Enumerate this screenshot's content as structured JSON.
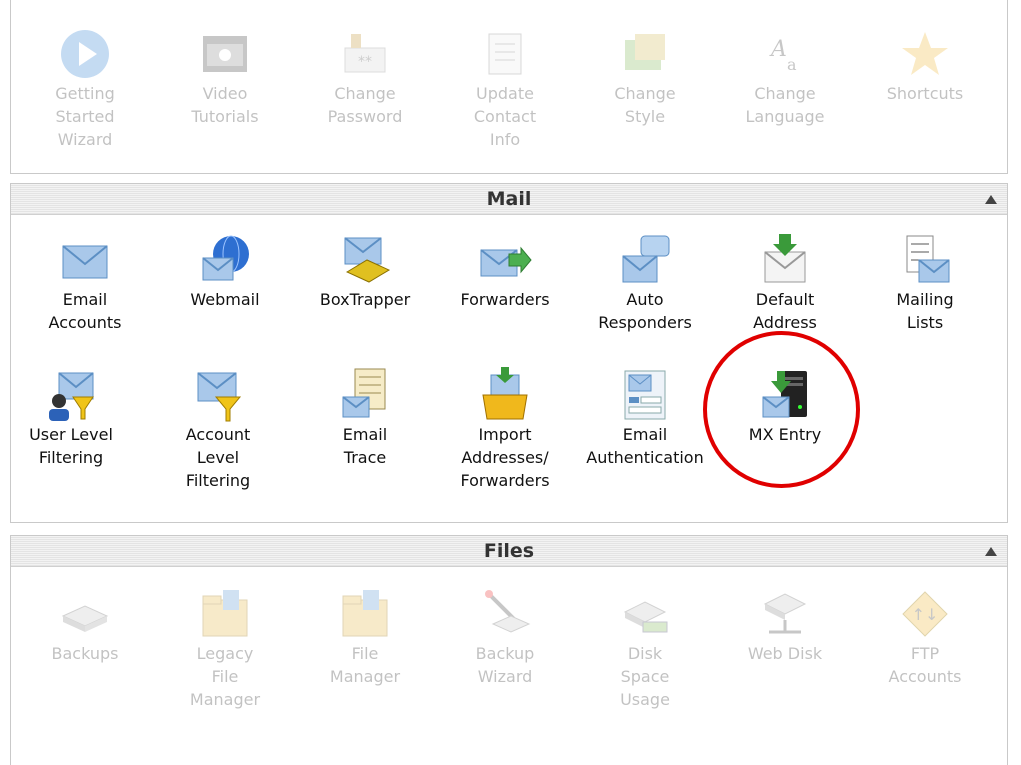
{
  "top": {
    "items": [
      {
        "label": "Getting\nStarted\nWizard",
        "icon": "play-icon"
      },
      {
        "label": "Video\nTutorials",
        "icon": "video-icon"
      },
      {
        "label": "Change\nPassword",
        "icon": "password-icon"
      },
      {
        "label": "Update\nContact\nInfo",
        "icon": "contact-icon"
      },
      {
        "label": "Change\nStyle",
        "icon": "style-icon"
      },
      {
        "label": "Change\nLanguage",
        "icon": "language-icon"
      },
      {
        "label": "Shortcuts",
        "icon": "star-icon"
      }
    ]
  },
  "mail": {
    "title": "Mail",
    "items": [
      {
        "label": "Email\nAccounts",
        "icon": "envelope-icon"
      },
      {
        "label": "Webmail",
        "icon": "globe-envelope-icon"
      },
      {
        "label": "BoxTrapper",
        "icon": "trap-envelope-icon"
      },
      {
        "label": "Forwarders",
        "icon": "forward-envelope-icon"
      },
      {
        "label": "Auto\nResponders",
        "icon": "speech-envelope-icon"
      },
      {
        "label": "Default\nAddress",
        "icon": "download-envelope-icon"
      },
      {
        "label": "Mailing\nLists",
        "icon": "list-envelope-icon"
      },
      {
        "label": "User Level\nFiltering",
        "icon": "user-filter-icon"
      },
      {
        "label": "Account\nLevel\nFiltering",
        "icon": "filter-envelope-icon"
      },
      {
        "label": "Email\nTrace",
        "icon": "trace-document-icon"
      },
      {
        "label": "Import\nAddresses/\nForwarders",
        "icon": "import-box-icon"
      },
      {
        "label": "Email\nAuthentication",
        "icon": "auth-envelope-icon"
      },
      {
        "label": "MX Entry",
        "icon": "server-envelope-icon"
      }
    ]
  },
  "files": {
    "title": "Files",
    "items": [
      {
        "label": "Backups",
        "icon": "disk-icon"
      },
      {
        "label": "Legacy\nFile\nManager",
        "icon": "folder-icon"
      },
      {
        "label": "File\nManager",
        "icon": "folder-icon"
      },
      {
        "label": "Backup\nWizard",
        "icon": "wand-disk-icon"
      },
      {
        "label": "Disk\nSpace\nUsage",
        "icon": "disk-usage-icon"
      },
      {
        "label": "Web Disk",
        "icon": "network-disk-icon"
      },
      {
        "label": "FTP\nAccounts",
        "icon": "ftp-icon"
      }
    ]
  },
  "colors": {
    "highlight_circle": "#e00000",
    "envelope": "#6fa3d8"
  }
}
